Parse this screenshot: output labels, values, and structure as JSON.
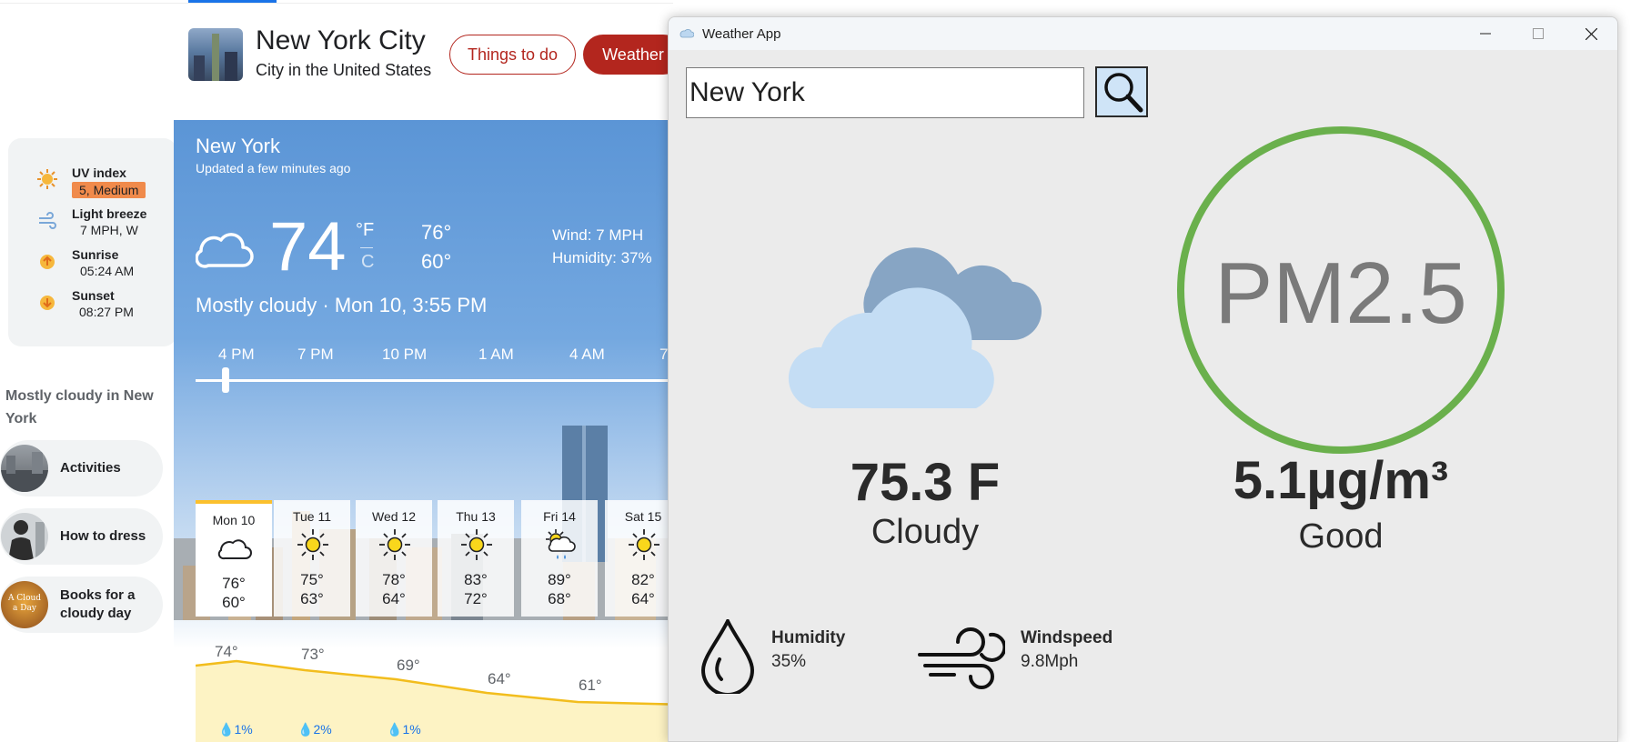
{
  "header": {
    "city_title": "New York City",
    "city_subtitle": "City in the United States",
    "pill_things": "Things to do",
    "pill_weather": "Weather"
  },
  "info_card": {
    "uv_label": "UV index",
    "uv_value": "5, Medium",
    "wind_label": "Light breeze",
    "wind_value": "7 MPH, W",
    "sunrise_label": "Sunrise",
    "sunrise_value": "05:24 AM",
    "sunset_label": "Sunset",
    "sunset_value": "08:27 PM"
  },
  "side": {
    "heading": "Mostly cloudy in New York",
    "items": [
      {
        "label": "Activities"
      },
      {
        "label": "How to dress"
      },
      {
        "label": "Books for a cloudy day"
      }
    ],
    "book_cover_text": "A Cloud a Day"
  },
  "weather": {
    "location": "New York",
    "updated": "Updated a few minutes ago",
    "temp": "74",
    "unit_f": "°F",
    "unit_c": "C",
    "high": "76°",
    "low": "60°",
    "wind": "Wind: 7 MPH",
    "humidity": "Humidity: 37%",
    "description": "Mostly cloudy · Mon 10, 3:55 PM",
    "hours": [
      "4 PM",
      "7 PM",
      "10 PM",
      "1 AM",
      "4 AM",
      "7"
    ],
    "slider_position_fraction": 0.054,
    "days": [
      {
        "name": "Mon 10",
        "icon": "cloud-icon",
        "high": "76°",
        "low": "60°"
      },
      {
        "name": "Tue 11",
        "icon": "sun-icon",
        "high": "75°",
        "low": "63°"
      },
      {
        "name": "Wed 12",
        "icon": "sun-icon",
        "high": "78°",
        "low": "64°"
      },
      {
        "name": "Thu 13",
        "icon": "sun-icon",
        "high": "83°",
        "low": "72°"
      },
      {
        "name": "Fri 14",
        "icon": "sun-rain-icon",
        "high": "89°",
        "low": "68°"
      },
      {
        "name": "Sat 15",
        "icon": "sun-icon",
        "high": "82°",
        "low": "64°"
      }
    ],
    "hourly_temps": [
      "74°",
      "73°",
      "69°",
      "64°",
      "61°"
    ],
    "precip": [
      "1%",
      "2%",
      "1%"
    ]
  },
  "app": {
    "title": "Weather App",
    "search_value": "New York",
    "temperature": "75.3 F",
    "condition": "Cloudy",
    "pm_label": "PM2.5",
    "pm_value": "5.1µg/m³",
    "pm_quality": "Good",
    "humidity_label": "Humidity",
    "humidity_value": "35%",
    "windspeed_label": "Windspeed",
    "windspeed_value": "9.8Mph",
    "colors": {
      "good_ring": "#6ab04c",
      "cloud_front": "#c4ddf4",
      "cloud_back": "#87a5c4",
      "brand_red": "#b3261e"
    }
  }
}
